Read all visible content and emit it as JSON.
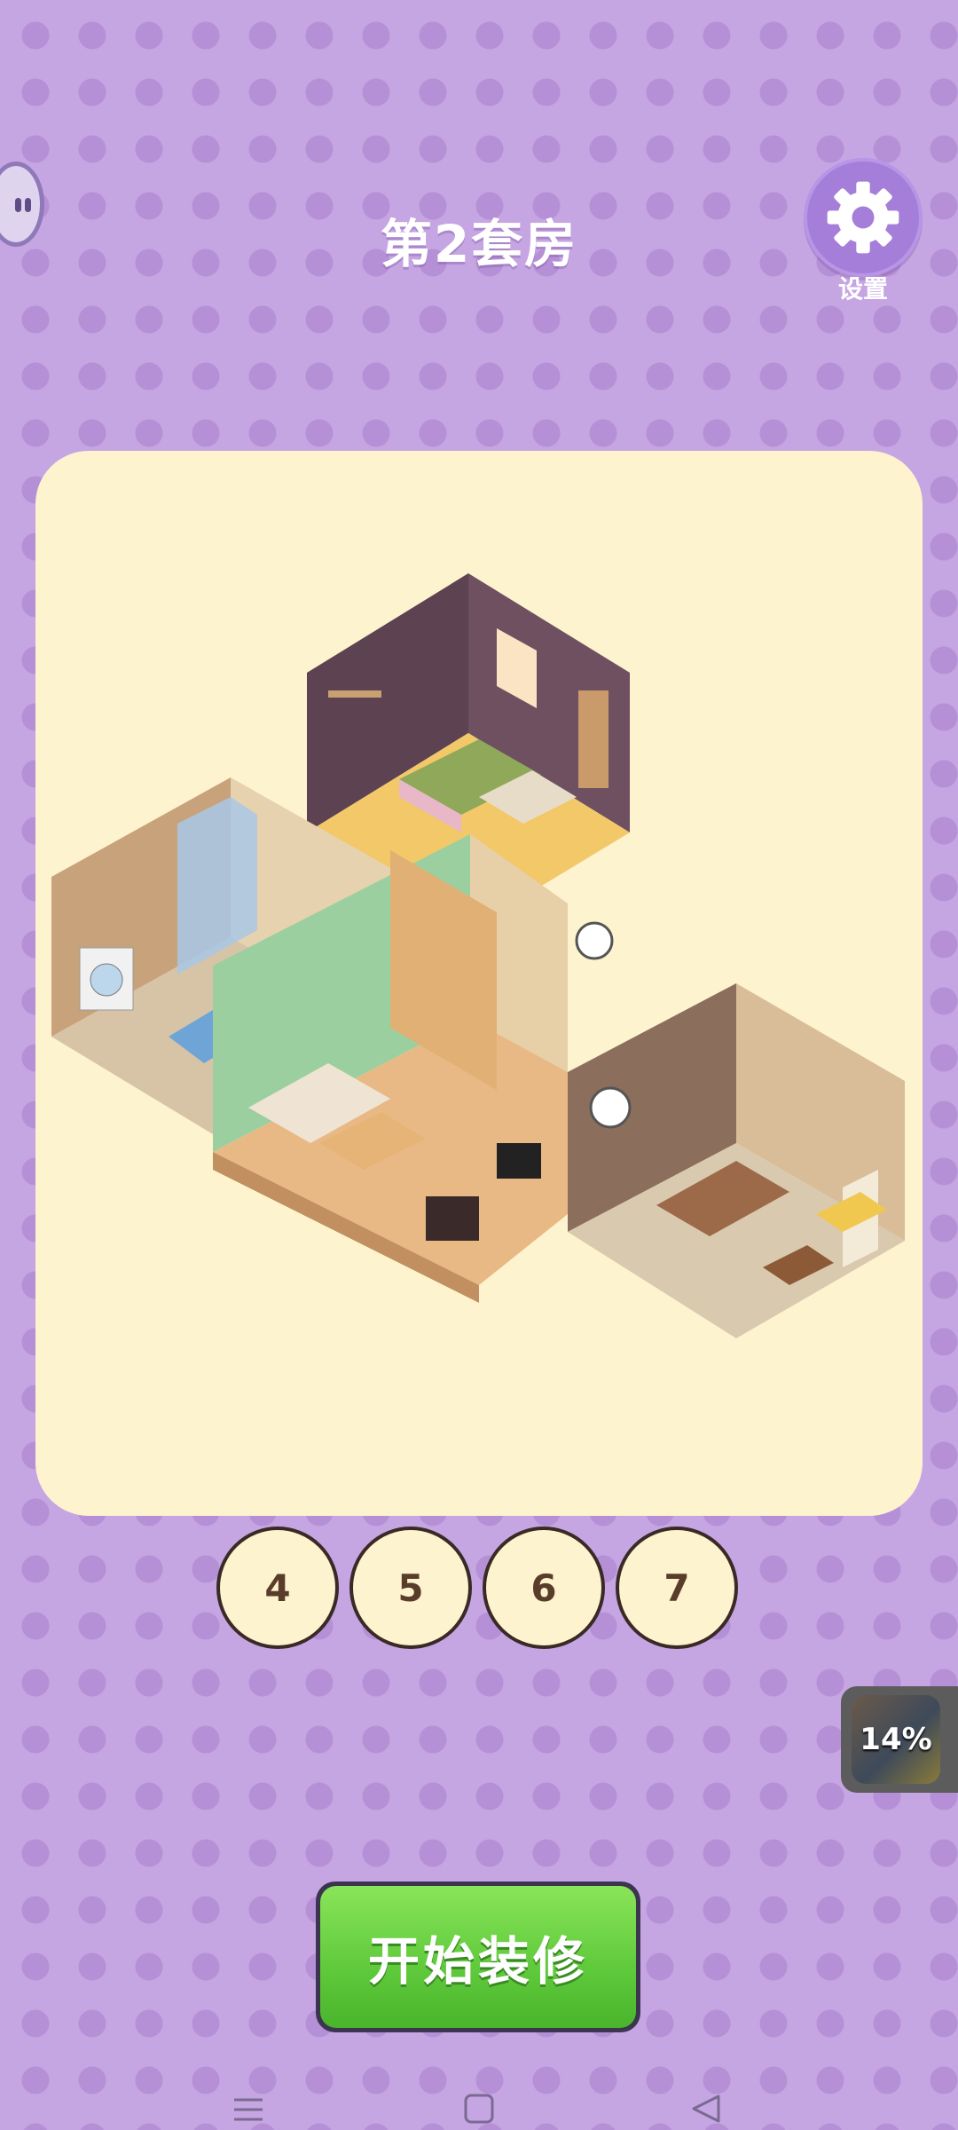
{
  "header": {
    "title": "第2套房",
    "settings_label": "设置"
  },
  "level_selector": {
    "levels": [
      "4",
      "5",
      "6",
      "7"
    ]
  },
  "progress": {
    "value": "14%"
  },
  "actions": {
    "start_label": "开始装修"
  },
  "colors": {
    "background": "#c6a6e2",
    "panel": "#fdf3cf",
    "accent_green": "#5ec93a",
    "settings_purple": "#a47ed8"
  },
  "icons": {
    "settings": "gear-icon",
    "profile": "avatar-icon",
    "nav_menu": "menu-icon",
    "nav_home": "square-icon",
    "nav_back": "triangle-back-icon"
  }
}
